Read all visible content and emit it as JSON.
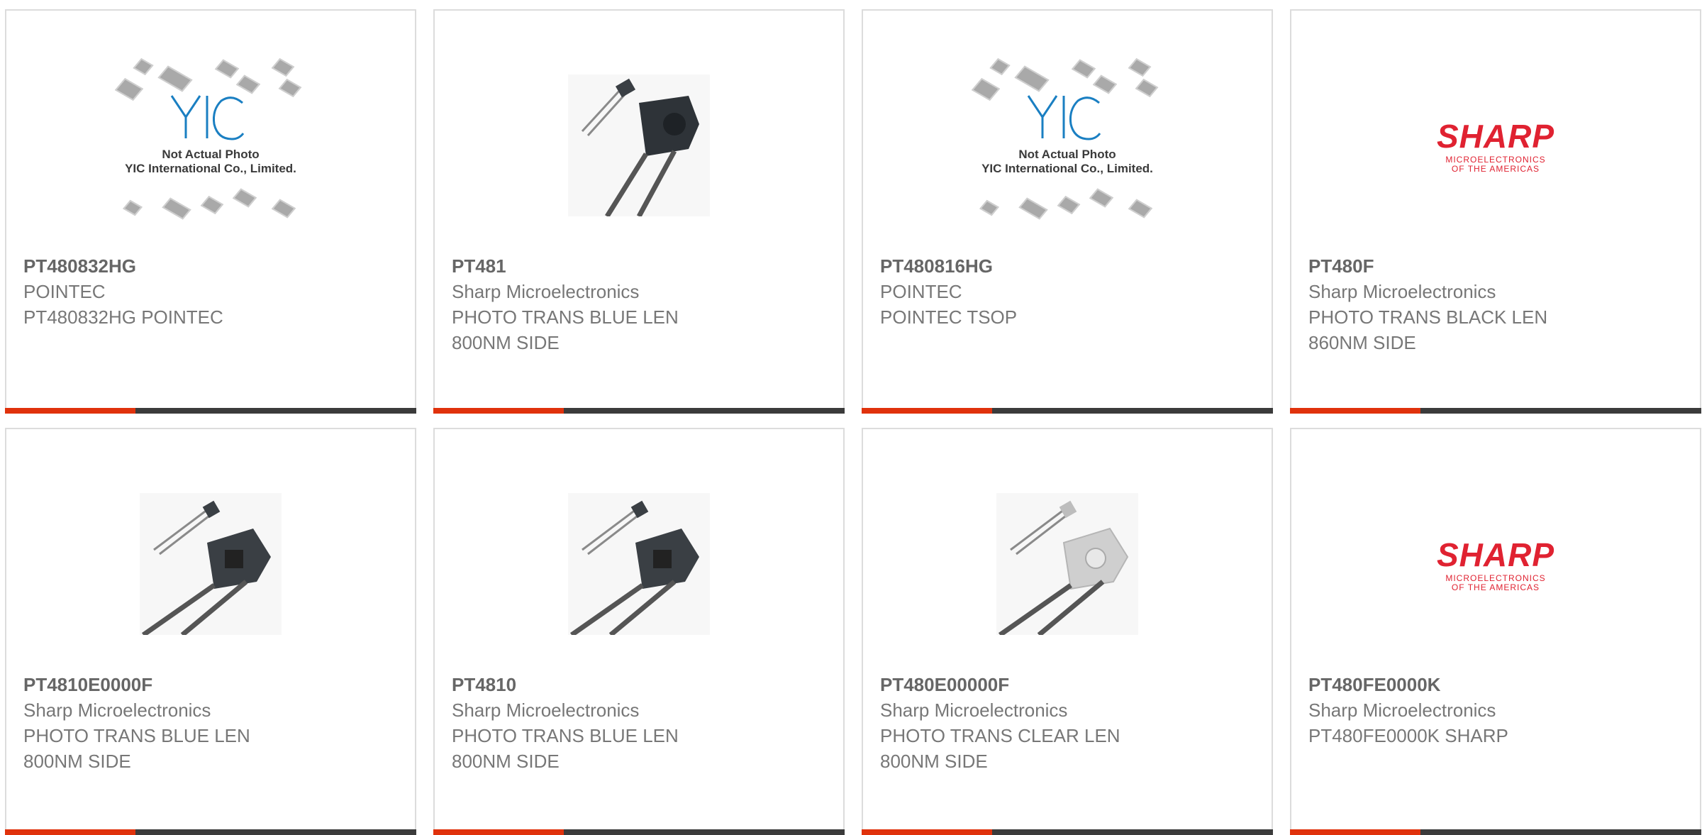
{
  "products": [
    {
      "part_number": "PT480832HG",
      "manufacturer": "POINTEC",
      "description_lines": [
        "PT480832HG POINTEC"
      ],
      "image": "yic-placeholder"
    },
    {
      "part_number": "PT481",
      "manufacturer": "Sharp Microelectronics",
      "description_lines": [
        "PHOTO TRANS BLUE LEN",
        "800NM SIDE"
      ],
      "image": "photo-transistor-dark"
    },
    {
      "part_number": "PT480816HG",
      "manufacturer": "POINTEC",
      "description_lines": [
        "POINTEC TSOP"
      ],
      "image": "yic-placeholder"
    },
    {
      "part_number": "PT480F",
      "manufacturer": "Sharp Microelectronics",
      "description_lines": [
        "PHOTO TRANS BLACK LEN",
        "860NM SIDE"
      ],
      "image": "sharp-logo"
    },
    {
      "part_number": "PT4810E0000F",
      "manufacturer": "Sharp Microelectronics",
      "description_lines": [
        "PHOTO TRANS BLUE LEN",
        "800NM SIDE"
      ],
      "image": "photo-transistor-dark"
    },
    {
      "part_number": "PT4810",
      "manufacturer": "Sharp Microelectronics",
      "description_lines": [
        "PHOTO TRANS BLUE LEN",
        "800NM SIDE"
      ],
      "image": "photo-transistor-dark"
    },
    {
      "part_number": "PT480E00000F",
      "manufacturer": "Sharp Microelectronics",
      "description_lines": [
        "PHOTO TRANS CLEAR LEN",
        "800NM SIDE"
      ],
      "image": "photo-transistor-clear"
    },
    {
      "part_number": "PT480FE0000K",
      "manufacturer": "Sharp Microelectronics",
      "description_lines": [
        "PT480FE0000K SHARP"
      ],
      "image": "sharp-logo"
    }
  ],
  "placeholder": {
    "caption_line1": "Not Actual Photo",
    "caption_line2": "YIC International Co., Limited.",
    "logo_text": "YIC"
  },
  "sharp_logo": {
    "brand": "SHARP",
    "sub_line1": "MICROELECTRONICS",
    "sub_line2": "OF THE AMERICAS"
  },
  "colors": {
    "accent": "#e0320c",
    "bar": "#3b3b3b",
    "border": "#dcdcdc",
    "text": "#707070",
    "sharp_red": "#e02231"
  }
}
